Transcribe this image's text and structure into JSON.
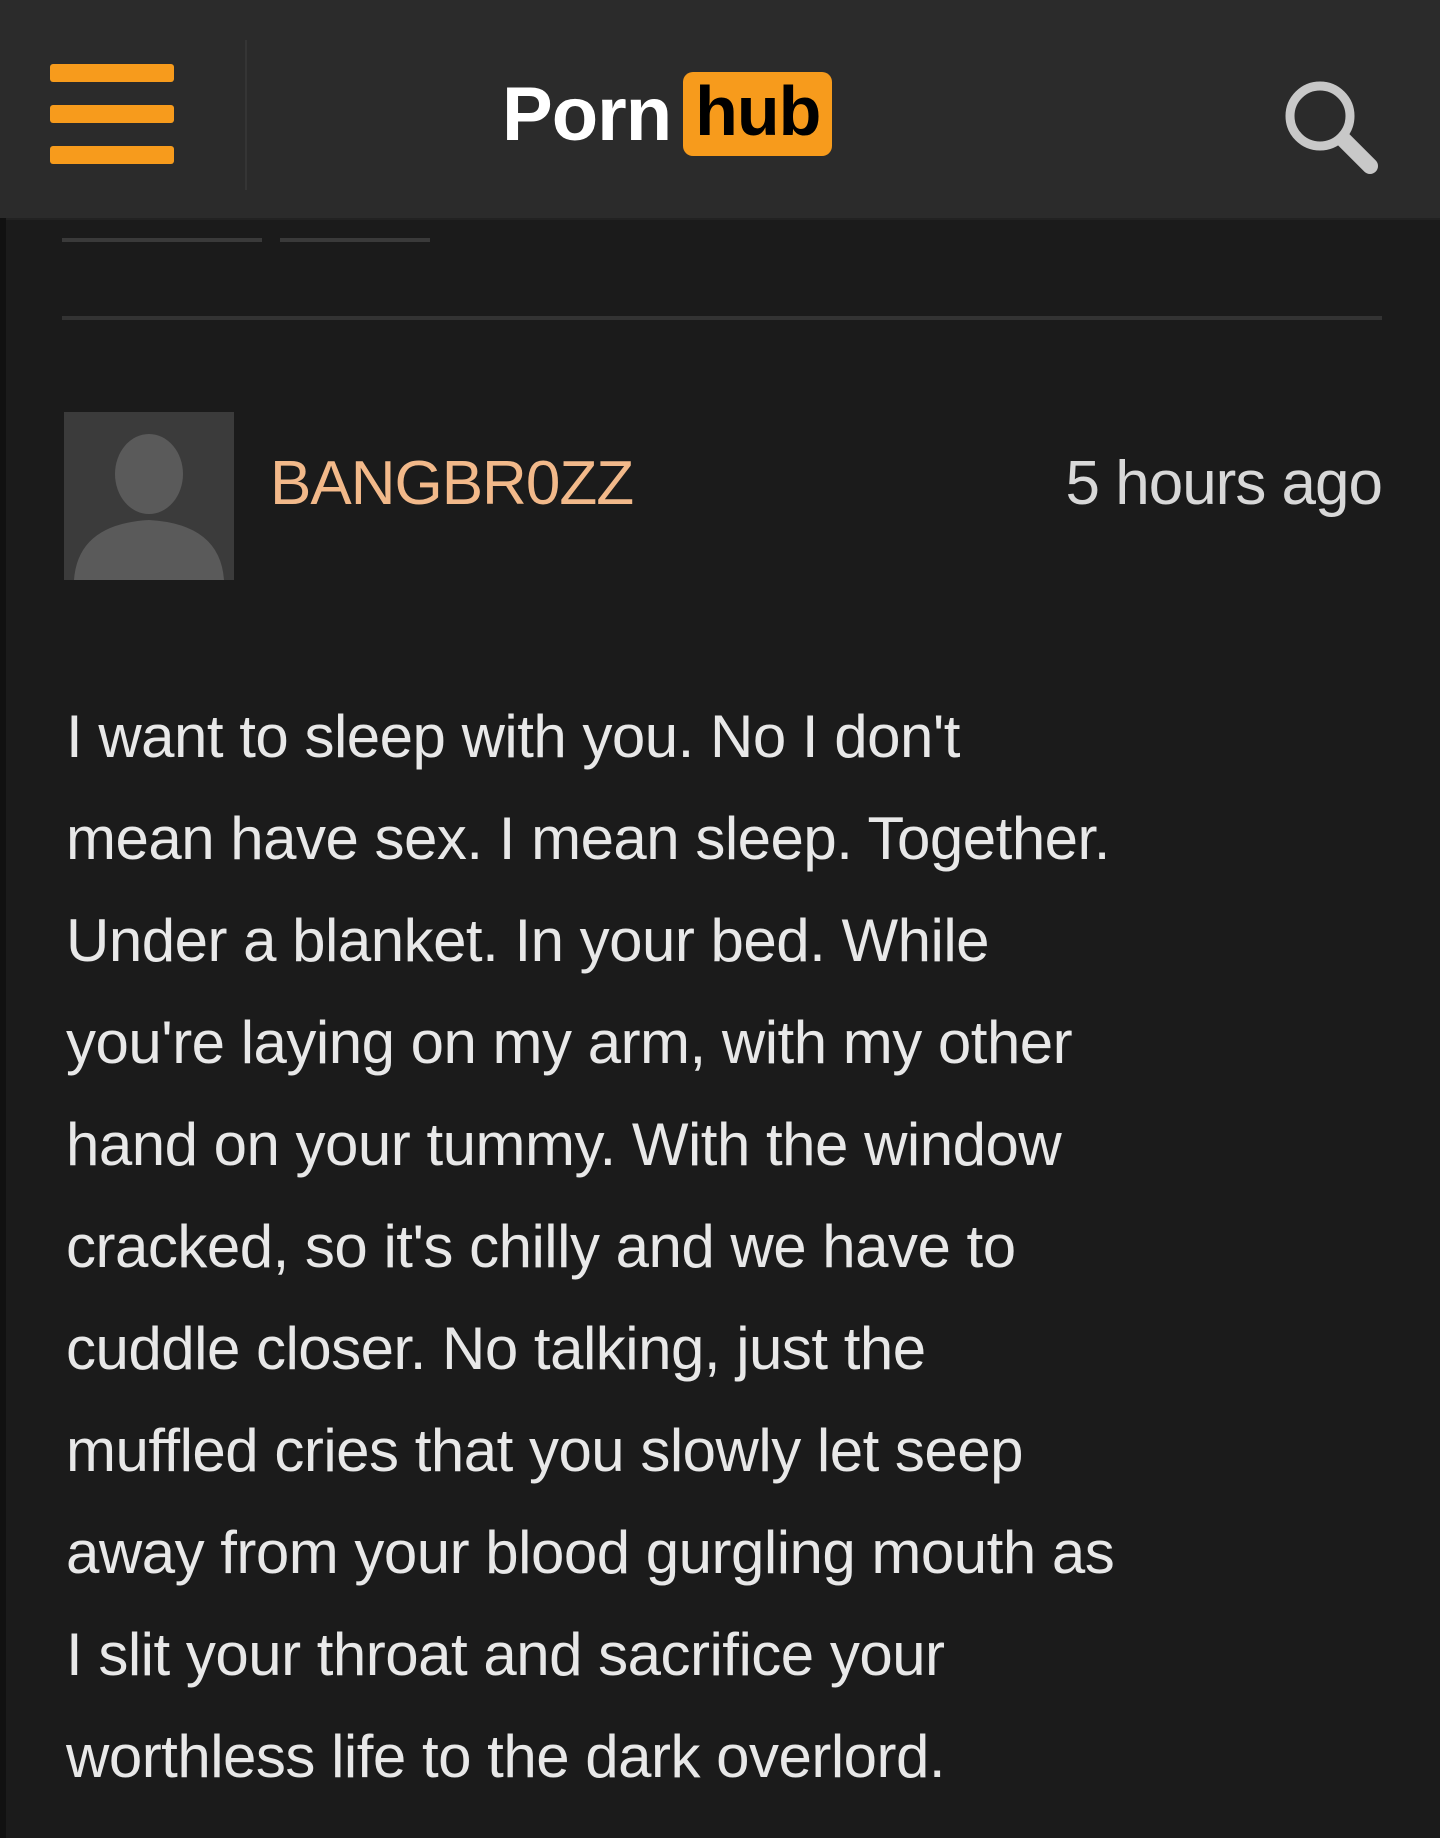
{
  "header": {
    "logo_left": "Porn",
    "logo_right": "hub",
    "menu_icon": "hamburger-menu-icon",
    "search_icon": "search-icon",
    "accent_color": "#f79b1c"
  },
  "comment": {
    "username": "BANGBR0ZZ",
    "timestamp": "5 hours ago",
    "avatar_icon": "default-user-silhouette-icon",
    "username_color": "#f2b98a",
    "body": "I want to sleep with you. No I don't\nmean have sex. I mean sleep. Together.\nUnder a blanket. In your bed. While\nyou're laying on my arm, with my other\nhand on your tummy. With the window\ncracked, so it's chilly and we have to\ncuddle closer. No talking, just the\nmuffled cries that you slowly let seep\naway from your blood gurgling mouth as\nI slit your throat and sacrifice your\nworthless life to the dark overlord."
  }
}
